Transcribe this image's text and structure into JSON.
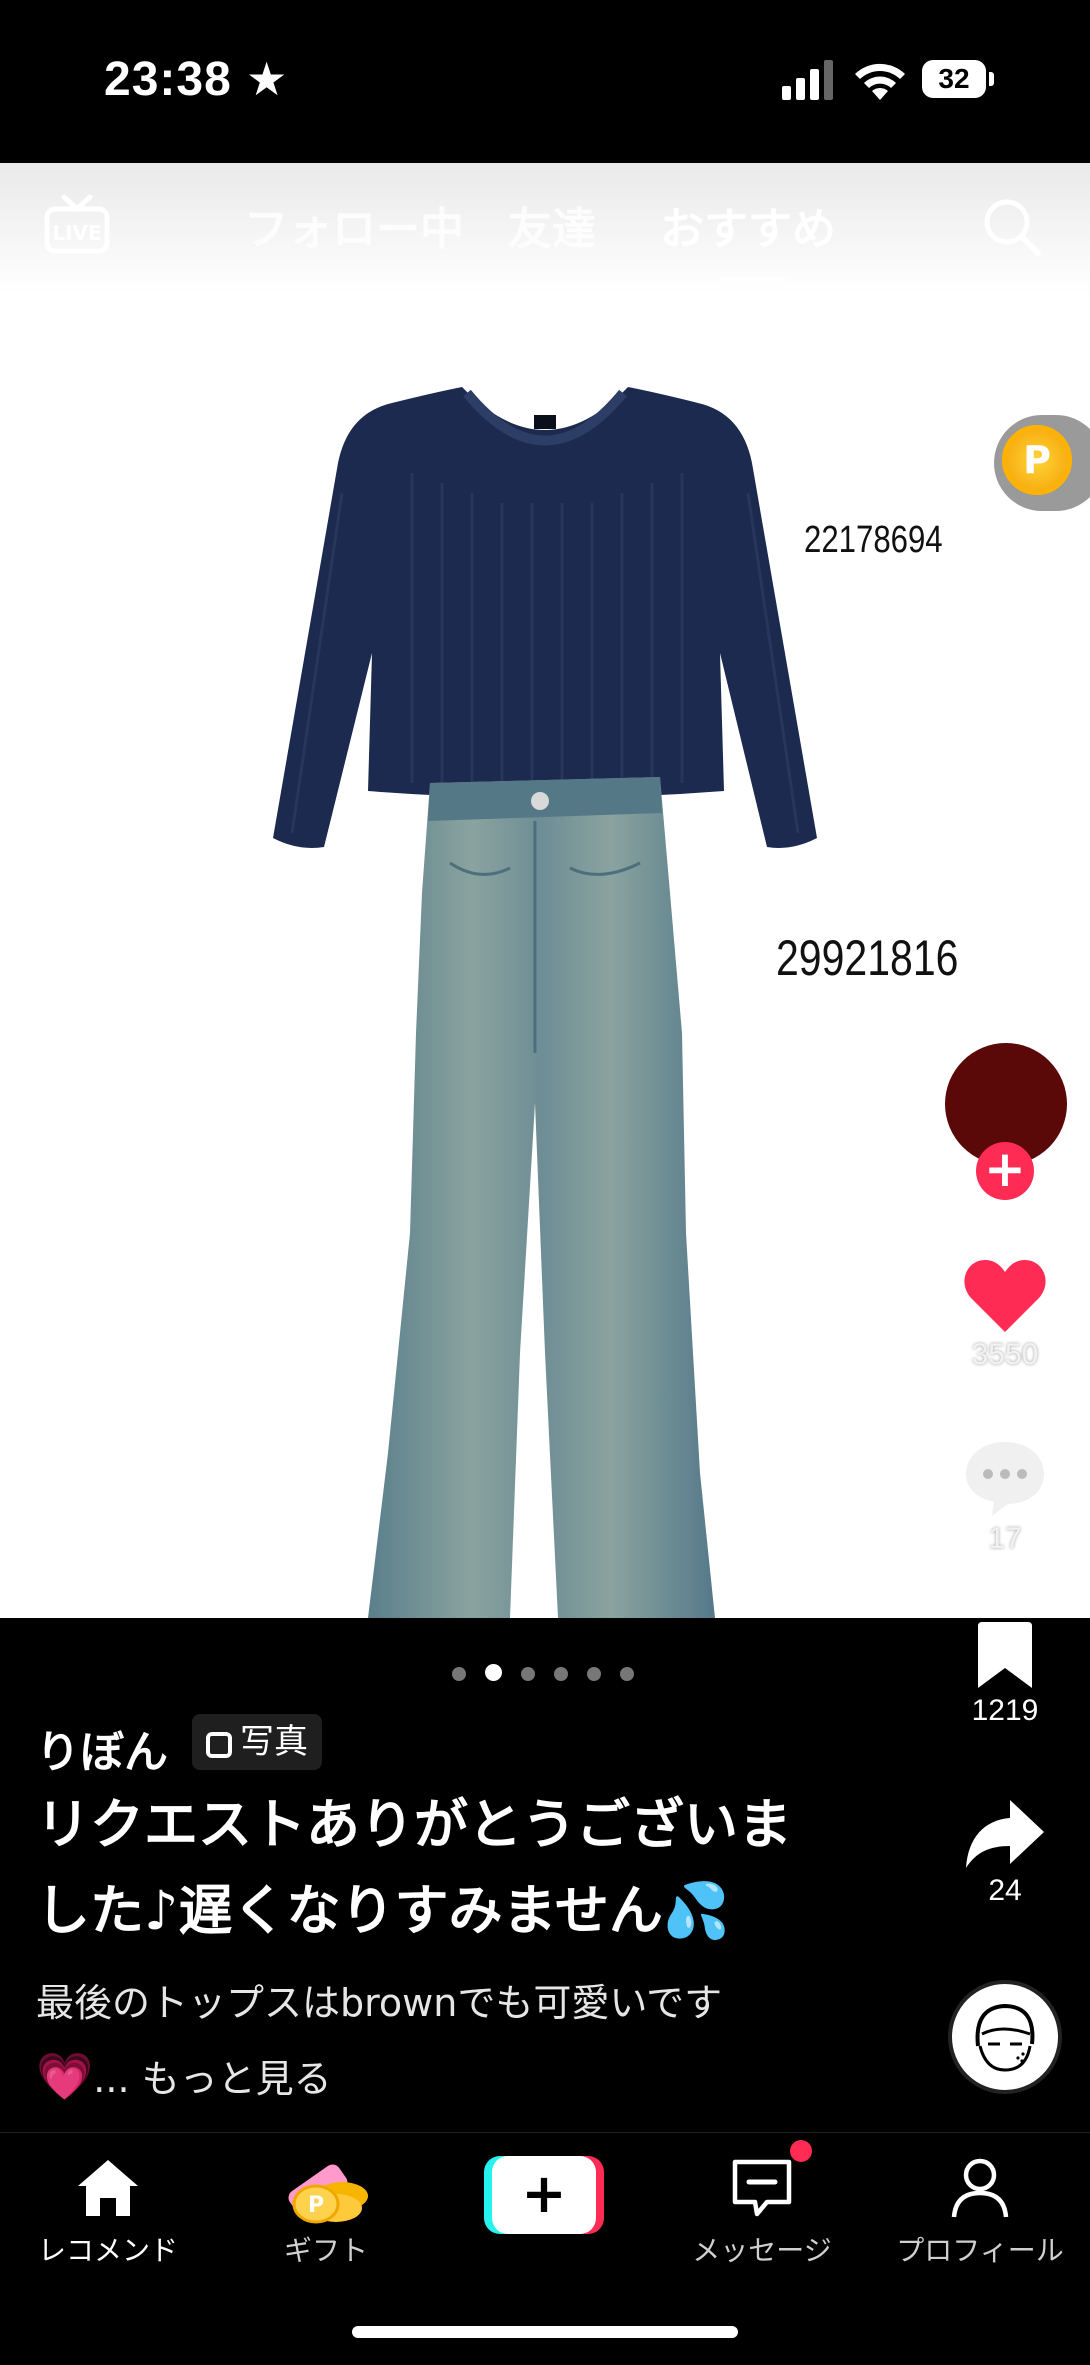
{
  "status": {
    "time": "23:38",
    "battery": "32"
  },
  "top_nav": {
    "live_label": "LIVE",
    "tabs": [
      {
        "label": "フォロー中"
      },
      {
        "label": "友達"
      },
      {
        "label": "おすすめ"
      }
    ],
    "active_tab": "おすすめ"
  },
  "content": {
    "top_code": "22178694",
    "bottom_code": "29921816",
    "coin_label": "P"
  },
  "actions": {
    "likes": "3550",
    "comments": "17",
    "saves": "1219",
    "shares": "24"
  },
  "carousel": {
    "count": 6,
    "active_index": 1
  },
  "post": {
    "username": "りぼん",
    "badge": "写真",
    "title_line1": "リクエストありがとうございま",
    "title_line2": "した♪遅くなりすみません💦",
    "desc_line1": "最後のトップスはbrownでも可愛いです",
    "desc_line2_emoji": "💗",
    "desc_line2": "... もっと見る"
  },
  "bottom_nav": {
    "home": "レコメンド",
    "gift": "ギフト",
    "create": "+",
    "messages": "メッセージ",
    "profile": "プロフィール"
  },
  "colors": {
    "accent": "#fe2c55",
    "cyan": "#25f4ee",
    "sweater": "#1b2a4e",
    "denim": "#5f8591"
  }
}
